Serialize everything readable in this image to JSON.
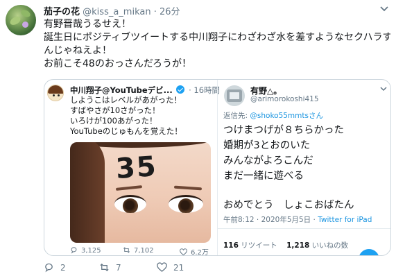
{
  "tweet": {
    "author_name": "茄子の花",
    "author_handle": "@kiss_a_mikan",
    "dot": "·",
    "time": "26分",
    "text_lines": [
      "有野晋哉うるせえ！",
      "誕生日にポジティブツイートする中川翔子にわざわざ水を差すようなセクハラす",
      "んじゃねえよ！",
      "お前こそ48のおっさんだろうが！"
    ],
    "actions": {
      "reply_count": "2",
      "retweet_count": "7",
      "like_count": "21"
    }
  },
  "quote_left": {
    "author_name": "中川翔子@YouTubeデビ...",
    "time": "· 16時間",
    "text_lines": [
      "しようこはレベルがあがった！",
      "すばやさが10さがった！",
      "いろけが100あがった！",
      "YouTubeのじゅもんを覚えた！"
    ],
    "photo_text": "35",
    "actions": {
      "reply_count": "3,125",
      "retweet_count": "7,102",
      "like_count": "6.2万"
    }
  },
  "quote_right": {
    "author_name": "有野△。",
    "author_handle": "@arimorokoshi415",
    "reply_prefix": "返信先: ",
    "reply_to": "@shoko55mmtsさん",
    "text_lines": [
      "つけまつげが８ちらかった",
      "婚期が3とおのいた",
      "みんながよろこんだ",
      "まだ一緒に遊べる"
    ],
    "text_last": "おめでとう　しょこおばたん",
    "timestamp": "午前8:12 · 2020年5月5日 · ",
    "source": "Twitter for iPad",
    "retweets_count": "116",
    "retweets_label": " リツイート",
    "likes_count": "1,218",
    "likes_label": " いいねの数"
  },
  "colors": {
    "accent": "#1da1f2",
    "secondary_text": "#657786",
    "border": "#ccd6dd"
  },
  "icons": [
    "chevron-down-icon",
    "verified-badge-icon",
    "reply-icon",
    "retweet-icon",
    "like-icon"
  ]
}
